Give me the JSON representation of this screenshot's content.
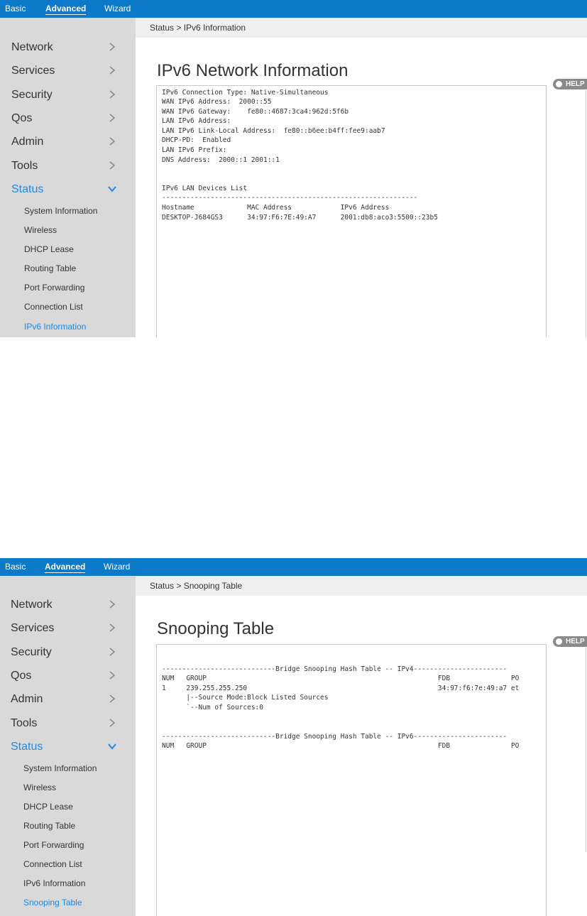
{
  "nav_tabs": [
    "Basic",
    "Advanced",
    "Wizard"
  ],
  "menu": {
    "items": [
      "Network",
      "Services",
      "Security",
      "Qos",
      "Admin",
      "Tools",
      "Status"
    ],
    "status_subitems": [
      "System Information",
      "Wireless",
      "DHCP Lease",
      "Routing Table",
      "Port Forwarding",
      "Connection List",
      "IPv6 Information",
      "Snooping Table"
    ]
  },
  "help_label": "HELP",
  "screen1": {
    "breadcrumb": "Status > IPv6 Information",
    "title": "IPv6 Network Information",
    "lines": [
      "IPv6 Connection Type: Native-Simultaneous",
      "WAN IPv6 Address:  2000::55",
      "WAN IPv6 Gateway:    fe80::4687:3ca4:962d:5f6b",
      "LAN IPv6 Address:",
      "LAN IPv6 Link-Local Address:  fe80::b6ee:b4ff:fee9:aab7",
      "DHCP-PD:  Enabled",
      "LAN IPv6 Prefix:",
      "DNS Address:  2000::1 2001::1",
      "",
      "",
      "IPv6 LAN Devices List",
      "---------------------------------------------------------------",
      "Hostname             MAC Address            IPv6 Address",
      "DESKTOP-J684GS3      34:97:F6:7E:49:A7      2001:db8:aco3:5500::23b5"
    ]
  },
  "screen2": {
    "breadcrumb": "Status > Snooping Table",
    "title": "Snooping Table",
    "lines": [
      "----------------------------Bridge Snooping Hash Table -- IPv4-----------------------",
      "NUM   GROUP                                                         FDB               PO",
      "1     239.255.255.250                                               34:97:f6:7e:49:a7 et",
      "      |--Source Mode:Block Listed Sources",
      "      `--Num of Sources:0",
      "",
      "",
      "----------------------------Bridge Snooping Hash Table -- IPv6-----------------------",
      "NUM   GROUP                                                         FDB               PO"
    ]
  }
}
